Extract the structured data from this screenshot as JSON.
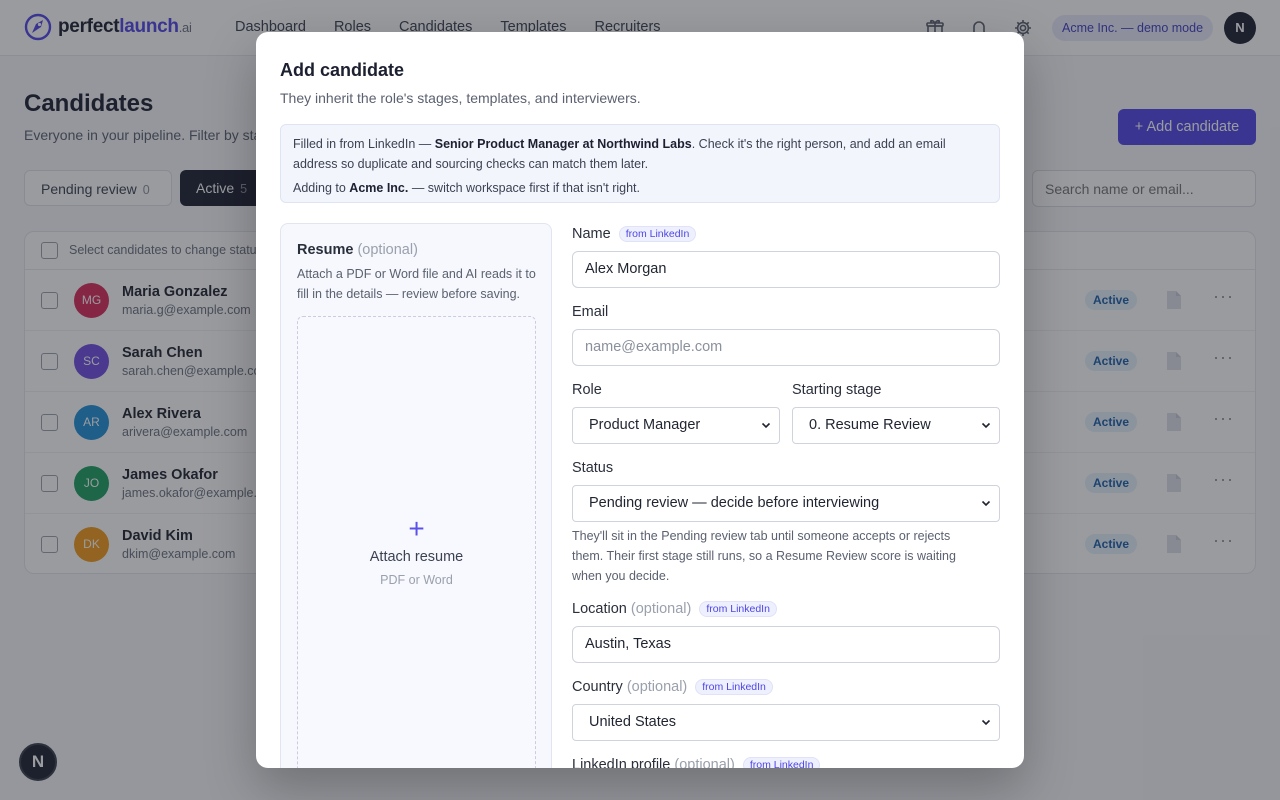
{
  "brand": {
    "name_plain": "perfect",
    "name_accent": "launch",
    "tld": ".ai"
  },
  "nav": {
    "items": [
      "Dashboard",
      "Roles",
      "Candidates",
      "Templates",
      "Recruiters"
    ]
  },
  "header": {
    "workspace_pill": "Acme Inc. — demo mode",
    "avatar_initial": "N",
    "icons": [
      "gift-icon",
      "bell-icon",
      "gear-icon"
    ]
  },
  "page": {
    "title": "Candidates",
    "subtitle": "Everyone in your pipeline. Filter by stage",
    "add_button": "+ Add candidate",
    "tabs": [
      {
        "label": "Pending review",
        "count": "0"
      },
      {
        "label": "Active",
        "count": "5"
      }
    ],
    "search_placeholder": "Search name or email...",
    "table_header": "Select candidates to change status",
    "rows": [
      {
        "initials": "MG",
        "name": "Maria Gonzalez",
        "email": "maria.g@example.com",
        "status": "Active",
        "color": "#d92b5a"
      },
      {
        "initials": "SC",
        "name": "Sarah Chen",
        "email": "sarah.chen@example.com",
        "status": "Active",
        "color": "#6d4ee0"
      },
      {
        "initials": "AR",
        "name": "Alex Rivera",
        "email": "arivera@example.com",
        "status": "Active",
        "color": "#1e90d6"
      },
      {
        "initials": "JO",
        "name": "James Okafor",
        "email": "james.okafor@example.com",
        "status": "Active",
        "color": "#1c9e62"
      },
      {
        "initials": "DK",
        "name": "David Kim",
        "email": "dkim@example.com",
        "status": "Active",
        "color": "#f09a1a"
      }
    ]
  },
  "dev_badge": "N",
  "modal": {
    "title": "Add candidate",
    "subtitle": "They inherit the role's stages, templates, and interviewers.",
    "notice": {
      "line1_prefix": "Filled in from LinkedIn — ",
      "line1_bold": "Senior Product Manager at Northwind Labs",
      "line1_suffix": ". Check it's the right person, and add an email address so duplicate and sourcing checks can match them later.",
      "line2_prefix": "Adding to ",
      "line2_bold": "Acme Inc.",
      "line2_suffix": " — switch workspace first if that isn't right."
    },
    "resume": {
      "title": "Resume",
      "optional": "(optional)",
      "help": "Attach a PDF or Word file and AI reads it to fill in the details — review before saving.",
      "plus": "+",
      "attach_label": "Attach resume",
      "formats": "PDF or Word"
    },
    "fields": {
      "name_label": "Name",
      "name_value": "Alex Morgan",
      "from_linkedin": "from LinkedIn",
      "email_label": "Email",
      "email_placeholder": "name@example.com",
      "role_label": "Role",
      "role_value": "Product Manager",
      "stage_label": "Starting stage",
      "stage_value": "0. Resume Review",
      "status_label": "Status",
      "status_value": "Pending review — decide before interviewing",
      "status_help": "They'll sit in the Pending review tab until someone accepts or rejects them. Their first stage still runs, so a Resume Review score is waiting when you decide.",
      "location_label": "Location",
      "location_value": "Austin, Texas",
      "country_label": "Country",
      "country_value": "United States",
      "linkedin_label": "LinkedIn profile",
      "optional": "(optional)"
    }
  }
}
